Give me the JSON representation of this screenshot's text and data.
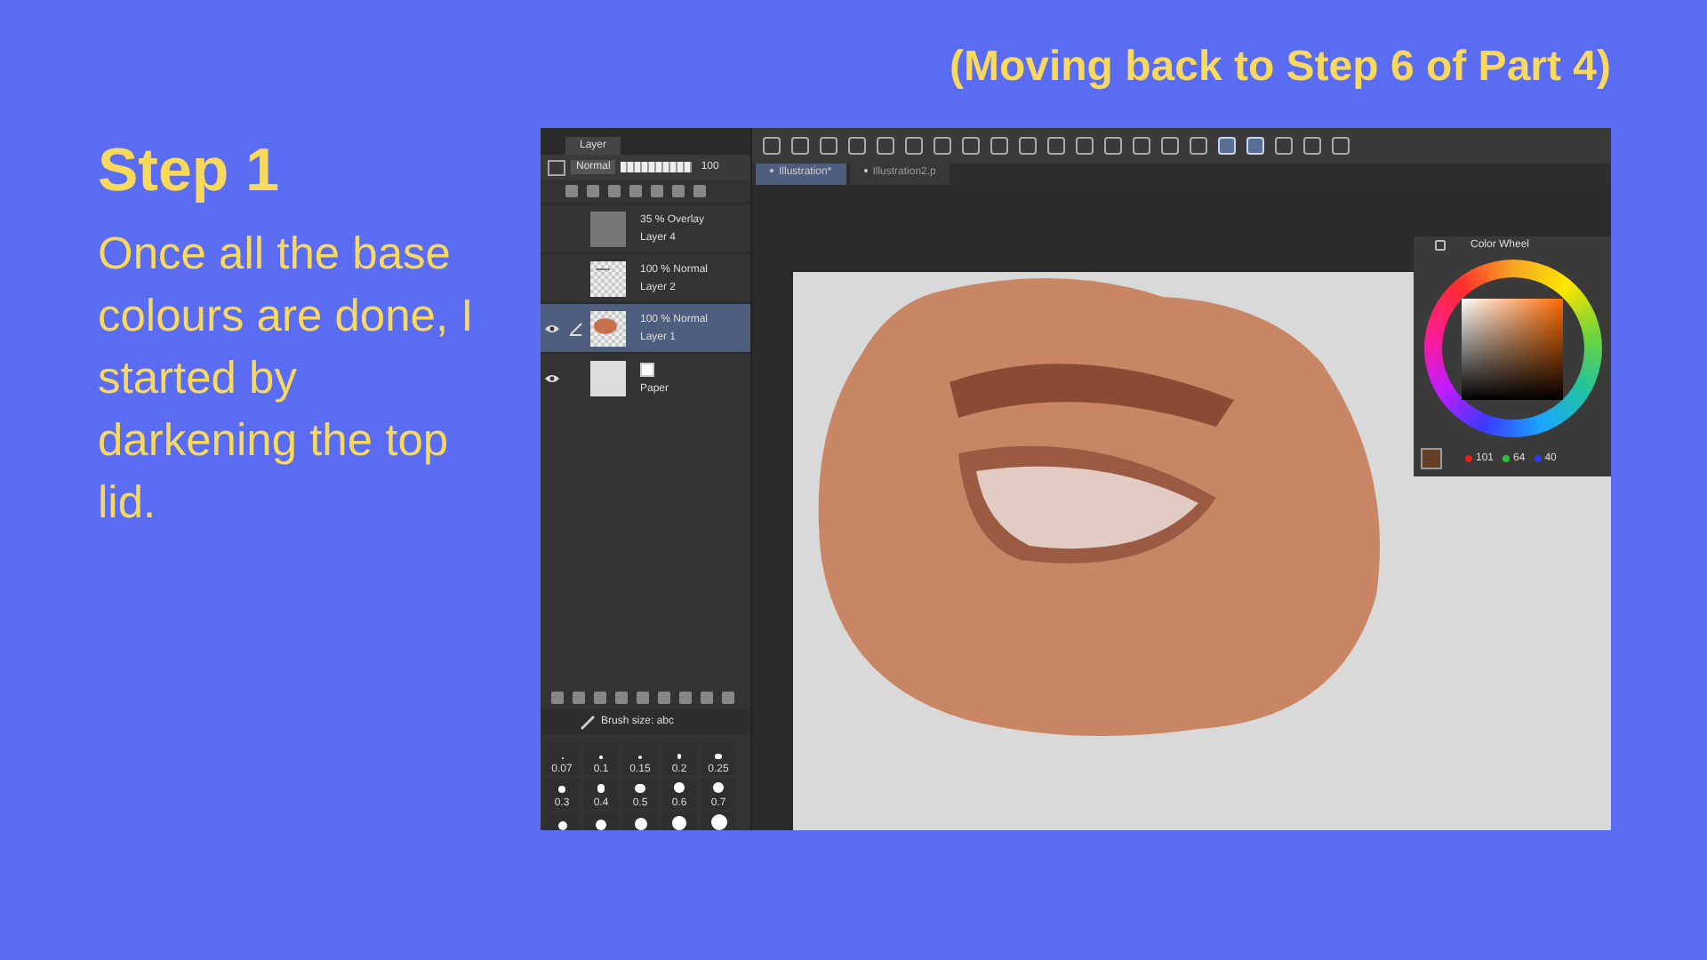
{
  "title": "(Moving back to Step 6 of Part 4)",
  "step": {
    "heading": "Step 1",
    "text": "Once all the base colours are done, I started by darkening the top lid."
  },
  "app": {
    "toolbar": [
      {
        "selected": false
      },
      {
        "selected": false
      },
      {
        "selected": false
      },
      {
        "selected": false
      },
      {
        "selected": false
      },
      {
        "selected": false
      },
      {
        "selected": false
      },
      {
        "selected": false
      },
      {
        "selected": false
      },
      {
        "selected": false
      },
      {
        "selected": false
      },
      {
        "selected": false
      },
      {
        "selected": false
      },
      {
        "selected": false
      },
      {
        "selected": false
      },
      {
        "selected": false
      },
      {
        "selected": true
      },
      {
        "selected": true
      },
      {
        "selected": false
      },
      {
        "selected": false
      },
      {
        "selected": false
      }
    ],
    "document_tabs": [
      {
        "label": "Illustration*",
        "selected": true
      },
      {
        "label": "Illustration2.p",
        "selected": false
      }
    ],
    "layer_panel": {
      "tab": "Layer",
      "blend_mode": "Normal",
      "opacity": "100",
      "opacity_slider": {
        "level": 1
      },
      "layers": [
        {
          "kind": "fill",
          "mode": "35 % Overlay",
          "name": "Layer 4",
          "visible": false,
          "selected": false
        },
        {
          "kind": "sketch",
          "mode": "100 % Normal",
          "name": "Layer 2",
          "visible": false,
          "selected": false
        },
        {
          "kind": "paint",
          "mode": "100 % Normal",
          "name": "Layer 1",
          "visible": true,
          "selected": true
        },
        {
          "kind": "paper",
          "name": "Paper",
          "visible": true,
          "selected": false
        }
      ]
    },
    "brush_size": {
      "title": "Brush size: abc",
      "sizes": [
        "0.07",
        "0.1",
        "0.15",
        "0.2",
        "0.25",
        "0.3",
        "0.4",
        "0.5",
        "0.6",
        "0.7"
      ]
    },
    "color_wheel": {
      "title": "Color Wheel",
      "r": "101",
      "g": "64",
      "b": "40"
    }
  }
}
